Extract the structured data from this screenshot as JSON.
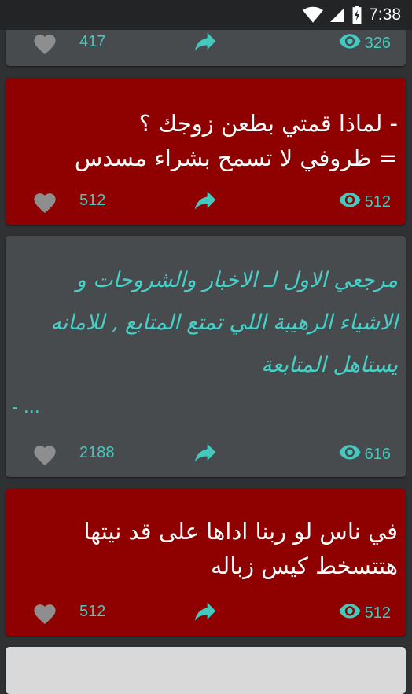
{
  "status_bar": {
    "time": "7:38",
    "icons": [
      "wifi-icon",
      "signal-icon",
      "battery-charging-icon"
    ]
  },
  "colors": {
    "accent": "#45c8be",
    "card_gray": "#484b4e",
    "card_red": "#8f0000",
    "background": "#2f3133"
  },
  "posts": [
    {
      "text": "",
      "likes": "417",
      "views": "326",
      "style": "gray"
    },
    {
      "text": "- لماذا قمتي بطعن زوجك ؟\n= ظروفي لا تسمح بشراء مسدس",
      "likes": "512",
      "views": "512",
      "style": "red"
    },
    {
      "text": "مرجعي الاول لـ الاخبار والشروحات و\nالاشياء الرهيبة اللي تمتع المتابع , للامانه\nيستاهل المتابعة",
      "extra_text": "- ...",
      "likes": "2188",
      "views": "616",
      "style": "gray"
    },
    {
      "text": "في ناس لو ربنا اداها على قد نيتها\nهتتسخط كيس زباله",
      "likes": "512",
      "views": "512",
      "style": "red"
    },
    {
      "text": "",
      "likes": "",
      "views": "",
      "style": "gray"
    }
  ]
}
